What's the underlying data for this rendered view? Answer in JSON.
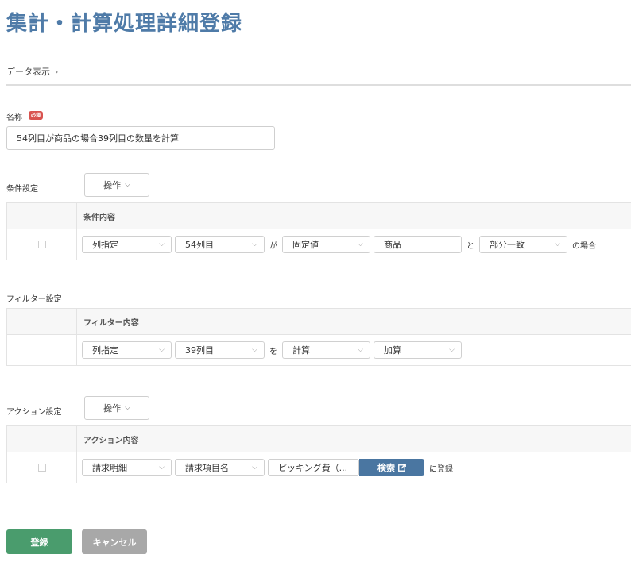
{
  "page": {
    "title": "集計・計算処理詳細登録"
  },
  "breadcrumb": {
    "item": "データ表示",
    "separator": "›"
  },
  "name_field": {
    "label": "名称",
    "required_badge": "必須",
    "value": "54列目が商品の場合39列目の数量を計算"
  },
  "conditions": {
    "label": "条件設定",
    "operation_button": "操作",
    "header": "条件内容",
    "row": {
      "column_type": "列指定",
      "column": "54列目",
      "conj1": "が",
      "value_type": "固定値",
      "value": "商品",
      "conj2": "と",
      "match": "部分一致",
      "suffix": "の場合"
    }
  },
  "filters": {
    "label": "フィルター設定",
    "header": "フィルター内容",
    "row": {
      "column_type": "列指定",
      "column": "39列目",
      "conj": "を",
      "op_type": "計算",
      "op": "加算"
    }
  },
  "actions": {
    "label": "アクション設定",
    "operation_button": "操作",
    "header": "アクション内容",
    "row": {
      "target": "請求明細",
      "field": "請求項目名",
      "value": "ピッキング費（...",
      "search_button": "検索",
      "suffix": "に登録"
    }
  },
  "footer": {
    "register_button": "登録",
    "cancel_button": "キャンセル"
  },
  "colors": {
    "title": "#4f7ba8",
    "register": "#4a9c6d",
    "cancel": "#a8a8a8",
    "search": "#4a76a1",
    "required": "#d9534f"
  },
  "icons": {
    "select_arrow": "chevron-down-icon",
    "breadcrumb_arrow": "chevron-right-icon",
    "external": "external-link-icon"
  }
}
